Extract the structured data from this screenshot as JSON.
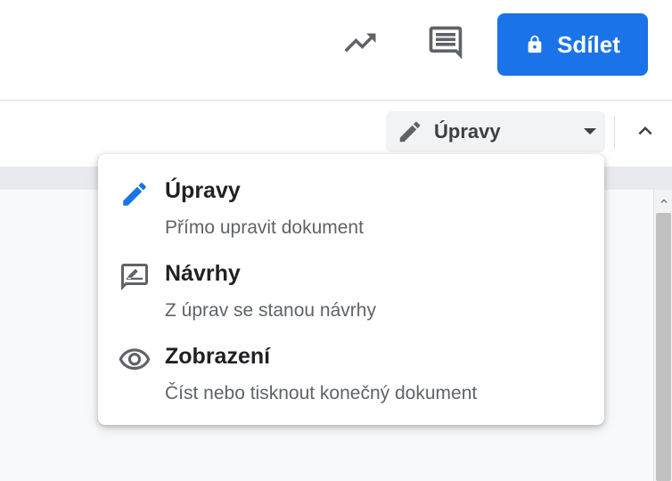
{
  "header": {
    "share_label": "Sdílet",
    "icons": {
      "activity": "trending-up-icon",
      "comments": "comment-icon",
      "share_lock": "lock-icon"
    }
  },
  "toolbar": {
    "mode_label": "Úpravy",
    "icons": {
      "mode": "pencil-icon",
      "caret": "caret-down-icon",
      "collapse": "chevron-up-icon"
    }
  },
  "menu": {
    "items": [
      {
        "title": "Úpravy",
        "description": "Přímo upravit dokument",
        "icon": "pencil-icon",
        "selected": true
      },
      {
        "title": "Návrhy",
        "description": "Z úprav se stanou návrhy",
        "icon": "suggest-edits-icon",
        "selected": false
      },
      {
        "title": "Zobrazení",
        "description": "Číst nebo tisknout konečný dokument",
        "icon": "eye-icon",
        "selected": false
      }
    ]
  },
  "colors": {
    "accent": "#1a73e8",
    "icon": "#5f6368",
    "text_primary": "#202124",
    "text_secondary": "#5f6368"
  }
}
